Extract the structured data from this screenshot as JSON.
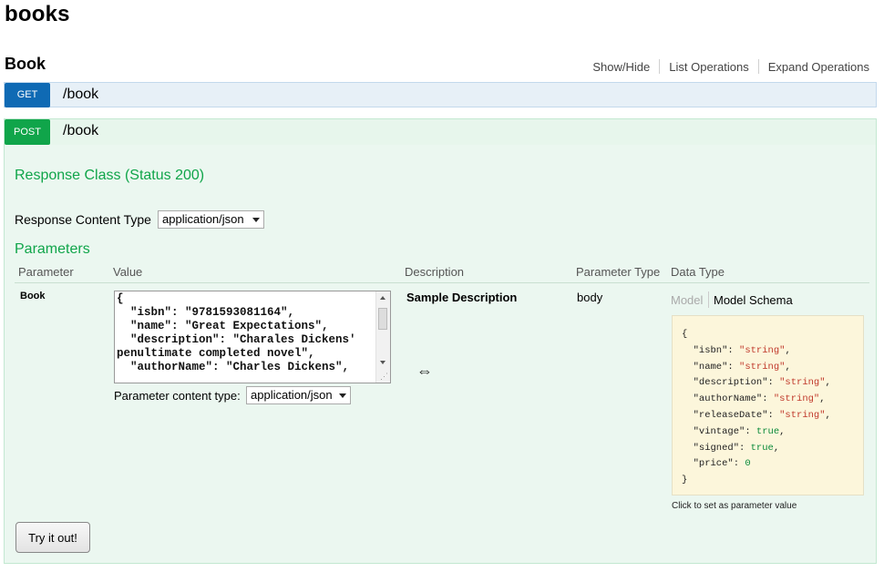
{
  "page": {
    "title": "books"
  },
  "resource": {
    "name": "Book",
    "links": [
      "Show/Hide",
      "List Operations",
      "Expand Operations"
    ]
  },
  "operations": {
    "get": {
      "method": "GET",
      "path": "/book"
    },
    "post": {
      "method": "POST",
      "path": "/book"
    }
  },
  "post_body": {
    "response_class_title": "Response Class (Status 200)",
    "response_content_type_label": "Response Content Type",
    "response_content_type_value": "application/json",
    "parameters_title": "Parameters",
    "columns": [
      "Parameter",
      "Value",
      "Description",
      "Parameter Type",
      "Data Type"
    ],
    "param": {
      "name": "Book",
      "value_text": "{\n  \"isbn\": \"9781593081164\",\n  \"name\": \"Great Expectations\",\n  \"description\": \"Charales Dickens' penultimate completed novel\",\n  \"authorName\": \"Charles Dickens\",",
      "content_type_label": "Parameter content type:",
      "content_type_value": "application/json",
      "description": "Sample Description",
      "param_type": "body",
      "tab_model": "Model",
      "tab_schema": "Model Schema",
      "schema": [
        {
          "key": "isbn",
          "value": "\"string\"",
          "kind": "s"
        },
        {
          "key": "name",
          "value": "\"string\"",
          "kind": "s"
        },
        {
          "key": "description",
          "value": "\"string\"",
          "kind": "s"
        },
        {
          "key": "authorName",
          "value": "\"string\"",
          "kind": "s"
        },
        {
          "key": "releaseDate",
          "value": "\"string\"",
          "kind": "s"
        },
        {
          "key": "vintage",
          "value": "true",
          "kind": "b"
        },
        {
          "key": "signed",
          "value": "true",
          "kind": "b"
        },
        {
          "key": "price",
          "value": "0",
          "kind": "n"
        }
      ],
      "click_hint": "Click to set as parameter value"
    },
    "try_button": "Try it out!"
  },
  "icons": {
    "drag": "resize-horizontal-icon"
  }
}
